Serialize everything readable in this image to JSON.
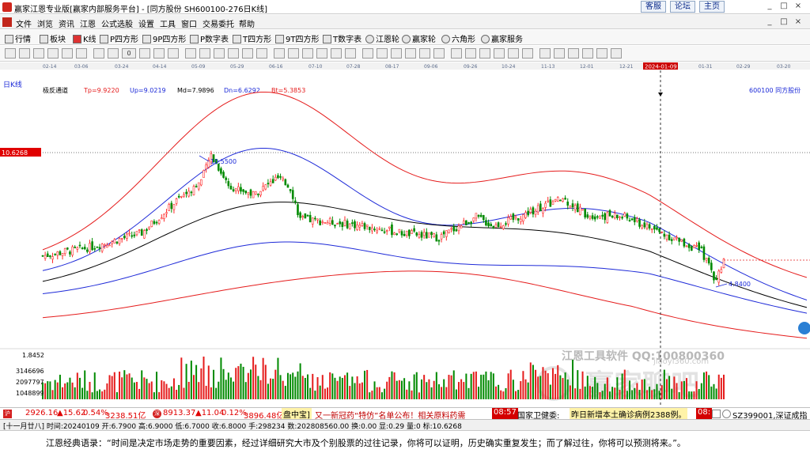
{
  "window": {
    "title": "赢家江恩专业版[赢家内部服务平台] - [同方股份  SH600100-276日K线]",
    "links": [
      "客服",
      "论坛",
      "主页"
    ],
    "controls": [
      "_",
      "□",
      "×"
    ]
  },
  "menu": {
    "items": [
      "文件",
      "浏览",
      "资讯",
      "江恩",
      "公式选股",
      "设置",
      "工具",
      "窗口",
      "交易委托",
      "帮助"
    ],
    "right_controls": [
      "_",
      "□",
      "×"
    ]
  },
  "toolbar": {
    "items": [
      "行情",
      "板块",
      "K线",
      "P四方形",
      "9P四方形",
      "P数字表",
      "T四方形",
      "9T四方形",
      "T数字表",
      "江恩轮",
      "赢家轮",
      "六角形",
      "赢家服务"
    ]
  },
  "toolbar2": {
    "count": 44,
    "selector_value": "0"
  },
  "chart": {
    "period_label": "日K线",
    "indicator": {
      "name": "极反通道",
      "tp": "Tp=9.9220",
      "up": "Up=9.0219",
      "md": "Md=7.9896",
      "dn": "Dn=6.6292",
      "bt": "Bt=5.3853"
    },
    "stock_label": "600100  同方股份",
    "date_ticks": [
      "02-14",
      "03-06",
      "03-24",
      "04-14",
      "05-09",
      "05-29",
      "06-16",
      "07-10",
      "07-28",
      "08-17",
      "09-06",
      "09-26",
      "10-24",
      "11-13",
      "12-01",
      "12-21",
      "2024-01-09",
      "01-31",
      "02-29",
      "03-20"
    ],
    "cursor_date": "2024-01-09",
    "price_label": "10.6268",
    "high_annotation": "10.5500",
    "low_annotation": "4.8400",
    "volume_labels": [
      "1.8452",
      "3146696",
      "2097797",
      "1048899"
    ],
    "watermark_top": "江恩工具软件  QQ:100800360",
    "watermark_site": "jiaoyi360.com",
    "watermark_big": "赢家聊吧",
    "colors": {
      "up": "#ff2a2a",
      "down": "#008a00",
      "mid_line": "#000000",
      "inner_band": "#1e2ad8",
      "outer_band": "#e51c1c",
      "price_tag": "#e00000"
    }
  },
  "ticker": {
    "sh_index": "2926.16",
    "sh_change": "▲15.62",
    "sh_pct": "0.54%",
    "sh_amount": "3238.51亿",
    "sz_index": "8913.37",
    "sz_change": "▲11.04",
    "sz_pct": "0.12%",
    "sz_amount": "3896.48亿",
    "news1_source": "盘中宝]",
    "news1_text": "又一新冠药“特仿”名单公布！相关原料药需",
    "news1_time": "08:57",
    "news2_source": "国家卫健委:",
    "news2_text": "昨日新增本土确诊病例2388例。",
    "news2_time": "08:",
    "right_code": "SZ399001,深证成指"
  },
  "statusbar": {
    "text": "[十一月廿八] 时间:20240109 开:6.7900 高:6.9000 低:6.7000 收:6.8000 手:298234 数:202808560.00 换:0.00 显:0.29 量:0 标:10.6268"
  },
  "quote": {
    "text": "江恩经典语录：“时间是决定市场走势的重要因素，经过详细研究大市及个别股票的过往记录，你将可以证明，历史确实重复发生；而了解过往，你将可以预测将来。”。"
  }
}
